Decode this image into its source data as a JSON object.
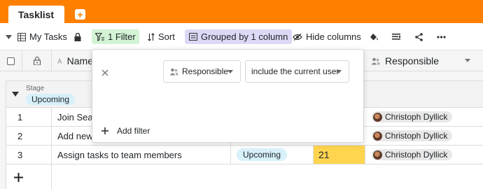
{
  "tabs": [
    {
      "label": "Tasklist"
    }
  ],
  "colors": {
    "accent": "#ff8000",
    "filter_chip": "#d2f3d4",
    "group_chip": "#dcd9f7",
    "stage_pill": "#d7f0fa",
    "highlight_cell": "#ffd54f"
  },
  "toolbar": {
    "view_label": "My Tasks",
    "filter_label": "1 Filter",
    "sort_label": "Sort",
    "group_label": "Grouped by 1 column",
    "hide_label": "Hide columns"
  },
  "columns": {
    "name": "Name",
    "responsible": "Responsible"
  },
  "group": {
    "field": "Stage",
    "value": "Upcoming"
  },
  "rows": [
    {
      "num": "1",
      "name": "Join SeaTable",
      "stage": "",
      "value": "",
      "person": "Christoph Dyllick"
    },
    {
      "num": "2",
      "name": "Add new team members",
      "stage": "",
      "value": "",
      "person": "Christoph Dyllick"
    },
    {
      "num": "3",
      "name": "Assign tasks to team members",
      "stage": "Upcoming",
      "value": "21",
      "person": "Christoph Dyllick"
    }
  ],
  "filter": {
    "field": "Responsible",
    "condition": "include the current user",
    "add_label": "Add filter"
  }
}
